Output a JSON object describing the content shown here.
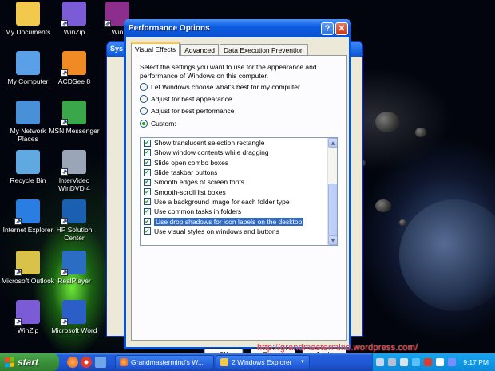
{
  "desktop_icons": [
    {
      "label": "My Documents",
      "icon": "folder-documents-icon",
      "color": "#f2c94c"
    },
    {
      "label": "WinZip",
      "icon": "winzip-icon",
      "color": "#7b5bd6"
    },
    {
      "label": "Win",
      "icon": "winrar-icon",
      "color": "#8c2f8c"
    },
    {
      "label": "My Computer",
      "icon": "computer-icon",
      "color": "#5aa0e8"
    },
    {
      "label": "ACDSee 8",
      "icon": "acdsee-icon",
      "color": "#f08a24"
    },
    {
      "label": "My Network Places",
      "icon": "network-icon",
      "color": "#4a90d9"
    },
    {
      "label": "MSN Messenger",
      "icon": "msn-icon",
      "color": "#3aa84a"
    },
    {
      "label": "Recycle Bin",
      "icon": "recycle-bin-icon",
      "color": "#5fa8e0"
    },
    {
      "label": "InterVideo WinDVD 4",
      "icon": "windvd-icon",
      "color": "#9aa6b8"
    },
    {
      "label": "Internet Explorer",
      "icon": "internet-explorer-icon",
      "color": "#2a7de1"
    },
    {
      "label": "HP Solution Center",
      "icon": "hp-icon",
      "color": "#1b5fb0"
    },
    {
      "label": "Microsoft Outlook",
      "icon": "outlook-icon",
      "color": "#d9c24a"
    },
    {
      "label": "RealPlayer",
      "icon": "realplayer-icon",
      "color": "#2b6cc4"
    },
    {
      "label": "WinZip",
      "icon": "winzip-icon",
      "color": "#7b5bd6"
    },
    {
      "label": "Microsoft Word",
      "icon": "word-icon",
      "color": "#2b5fc7"
    }
  ],
  "background_window": {
    "title": "Sys"
  },
  "dialog": {
    "title": "Performance Options",
    "tabs": [
      "Visual Effects",
      "Advanced",
      "Data Execution Prevention"
    ],
    "active_tab": 0,
    "description": "Select the settings you want to use for the appearance and performance of Windows on this computer.",
    "options": [
      {
        "label": "Let Windows choose what's best for my computer",
        "selected": false
      },
      {
        "label": "Adjust for best appearance",
        "selected": false
      },
      {
        "label": "Adjust for best performance",
        "selected": false
      },
      {
        "label": "Custom:",
        "selected": true
      }
    ],
    "effects": [
      {
        "label": "Show translucent selection rectangle",
        "checked": true
      },
      {
        "label": "Show window contents while dragging",
        "checked": true
      },
      {
        "label": "Slide open combo boxes",
        "checked": true
      },
      {
        "label": "Slide taskbar buttons",
        "checked": true
      },
      {
        "label": "Smooth edges of screen fonts",
        "checked": true
      },
      {
        "label": "Smooth-scroll list boxes",
        "checked": true
      },
      {
        "label": "Use a background image for each folder type",
        "checked": true
      },
      {
        "label": "Use common tasks in folders",
        "checked": true
      },
      {
        "label": "Use drop shadows for icon labels on the desktop",
        "checked": true,
        "selected": true
      },
      {
        "label": "Use visual styles on windows and buttons",
        "checked": true
      }
    ],
    "buttons": {
      "ok": "OK",
      "cancel": "Cancel",
      "apply": "Apply"
    }
  },
  "taskbar": {
    "start_label": "start",
    "tasks": [
      {
        "label": "Grandmastermind's W...",
        "icon": "firefox-icon"
      },
      {
        "label": "2 Windows Explorer",
        "icon": "folder-icon"
      }
    ],
    "clock": "9:17 PM"
  },
  "watermark": "http://grandmastermind.wordpress.com/"
}
